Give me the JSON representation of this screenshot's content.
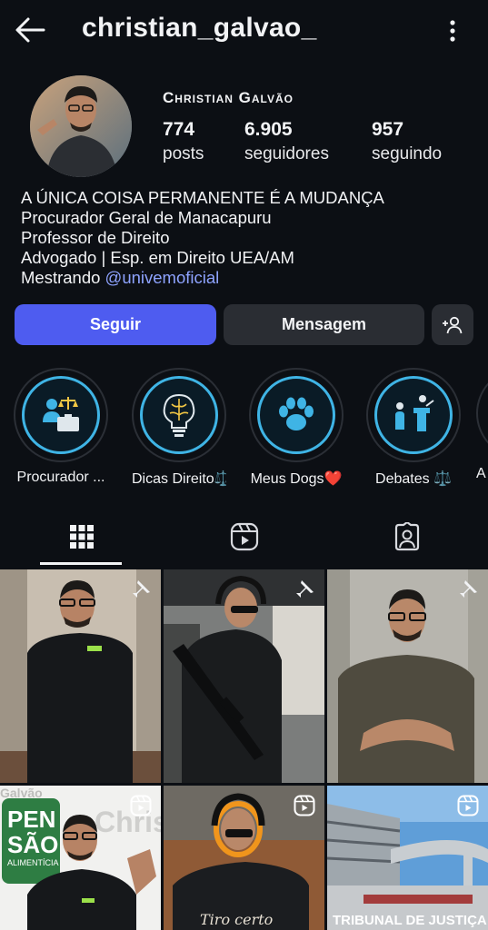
{
  "header": {
    "username": "christian_galvao_",
    "back_icon": "arrow-left-icon",
    "more_icon": "more-vertical-icon"
  },
  "profile": {
    "display_name": "Christian Galvão",
    "stats": [
      {
        "value": "774",
        "label": "posts"
      },
      {
        "value": "6.905",
        "label": "seguidores"
      },
      {
        "value": "957",
        "label": "seguindo"
      }
    ],
    "bio": {
      "line1": "A ÚNICA COISA PERMANENTE É A MUDANÇA",
      "line2": "Procurador Geral de Manacapuru",
      "line3": "Professor de Direito",
      "line4": "Advogado | Esp. em Direito UEA/AM",
      "line5_prefix": "Mestrando ",
      "mention": "@univemoficial"
    }
  },
  "actions": {
    "follow": "Seguir",
    "message": "Mensagem",
    "add_user_icon": "person-add-icon"
  },
  "highlights": [
    {
      "label": "Procurador ...",
      "icon": "justice-icon"
    },
    {
      "label": "Dicas Direito⚖️",
      "icon": "brain-icon"
    },
    {
      "label": "Meus Dogs❤️",
      "icon": "paw-icon"
    },
    {
      "label": "Debates ⚖️",
      "icon": "podium-icon"
    },
    {
      "label": "A",
      "icon": "highlight-icon"
    }
  ],
  "tabs": [
    {
      "name": "grid",
      "icon": "grid-icon",
      "active": true
    },
    {
      "name": "reels",
      "icon": "reels-icon",
      "active": false
    },
    {
      "name": "tagged",
      "icon": "tagged-icon",
      "active": false
    }
  ],
  "grid": {
    "row2": {
      "c1_text": {
        "pen": "PEN",
        "sao": "SÃO",
        "sub": "ALIMENTÍCIA",
        "bg": "Chris",
        "bg2": "Galvão"
      },
      "c2_text": "Tiro certo",
      "c3_text": "TRIBUNAL DE JUSTIÇA"
    },
    "badges": [
      "pin-icon",
      "pin-icon",
      "pin-icon",
      "reels-icon",
      "reels-icon",
      "reels-icon"
    ]
  },
  "colors": {
    "background": "#0c0f14",
    "follow_button": "#4e5cf0",
    "secondary_button": "#2a2d33",
    "mention": "#8ea3ff",
    "highlight_ring": "#3fb4e5"
  }
}
